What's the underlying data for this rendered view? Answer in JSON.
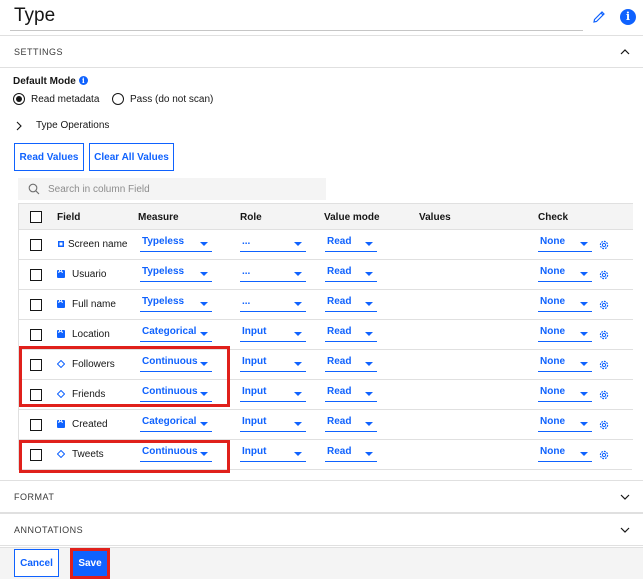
{
  "header": {
    "title": "Type"
  },
  "sections": {
    "settings": "SETTINGS",
    "format": "FORMAT",
    "annotations": "ANNOTATIONS"
  },
  "settings": {
    "default_mode_label": "Default Mode",
    "mode_options": [
      "Read metadata",
      "Pass (do not scan)"
    ],
    "selected_mode": "Read metadata",
    "type_operations_label": "Type Operations",
    "read_values_button": "Read Values",
    "clear_all_values_button": "Clear All Values",
    "search_placeholder": "Search in column Field"
  },
  "table": {
    "columns": [
      "Field",
      "Measure",
      "Role",
      "Value mode",
      "Values",
      "Check"
    ],
    "rows": [
      {
        "field": "Screen name",
        "icon": "typeless-icon",
        "measure": "Typeless",
        "role": "...",
        "value_mode": "Read",
        "values": "",
        "check": "None"
      },
      {
        "field": "Usuario",
        "icon": "categorical-icon",
        "measure": "Typeless",
        "role": "...",
        "value_mode": "Read",
        "values": "",
        "check": "None"
      },
      {
        "field": "Full name",
        "icon": "categorical-icon",
        "measure": "Typeless",
        "role": "...",
        "value_mode": "Read",
        "values": "",
        "check": "None"
      },
      {
        "field": "Location",
        "icon": "categorical-icon",
        "measure": "Categorical",
        "role": "Input",
        "value_mode": "Read",
        "values": "",
        "check": "None"
      },
      {
        "field": "Followers",
        "icon": "continuous-icon",
        "measure": "Continuous",
        "role": "Input",
        "value_mode": "Read",
        "values": "",
        "check": "None"
      },
      {
        "field": "Friends",
        "icon": "continuous-icon",
        "measure": "Continuous",
        "role": "Input",
        "value_mode": "Read",
        "values": "",
        "check": "None"
      },
      {
        "field": "Created",
        "icon": "categorical-icon",
        "measure": "Categorical",
        "role": "Input",
        "value_mode": "Read",
        "values": "",
        "check": "None"
      },
      {
        "field": "Tweets",
        "icon": "continuous-icon",
        "measure": "Continuous",
        "role": "Input",
        "value_mode": "Read",
        "values": "",
        "check": "None"
      }
    ]
  },
  "footer": {
    "cancel_label": "Cancel",
    "save_label": "Save"
  },
  "colors": {
    "accent": "#0f62fe",
    "highlight": "#e0201b"
  }
}
